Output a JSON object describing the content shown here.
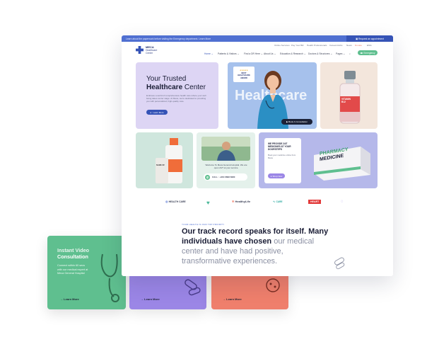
{
  "cards": {
    "green": {
      "title_line1": "Instant Video",
      "title_line2": "Consultation",
      "text_line1": "Connect within 60 secs",
      "text_line2": "with our medical expert at",
      "text_line3": "Meca General Hospital",
      "learn": "Learn More"
    },
    "purple": {
      "learn": "Learn More"
    },
    "orange": {
      "learn": "Learn More"
    }
  },
  "topbar": {
    "notice": "Learn about the paperwork before visiting the Emergency department. Learn More",
    "button": "Request an appointment"
  },
  "utility": [
    "Online Services",
    "Pay Your Bill",
    "Health Professionals",
    "Careers/Jobs",
    "News",
    "Donate",
    "ENG"
  ],
  "logo": {
    "line1": "MECA",
    "line2": "Healthcare",
    "line3": "Center"
  },
  "nav": [
    "Home",
    "Patients & Visitors",
    "Find a DR Here",
    "About Us",
    "Education & Research",
    "Doctors & Structures",
    "Pages"
  ],
  "appointment_button": "Emergency",
  "hero": {
    "title_line1": "Your Trusted",
    "title_bold": "Healthcare",
    "title_rest": " Center",
    "sub": "Embrace a world of comprehensive health care where your well being takes center stage. At Meca, we're dedicated to providing you with personalized, high-quality care.",
    "button": "Learn More"
  },
  "hero_image": {
    "badge_line1": "BEST",
    "badge_line2": "HEALTHCARE",
    "badge_line3": "AWARD",
    "overlay": "Healthcare",
    "consult": "Book A Consultation"
  },
  "vial": {
    "label_line1": "VITAMIN",
    "label_line2": "B12"
  },
  "welcome": {
    "text_line1": "Welcome To Meca General Hospital. We are",
    "text_line2": "open 24/7 at your service.",
    "call": "CALL : +964 6898 6980"
  },
  "pharmacy": {
    "heading_line1": "WE PROVIDE 24/7",
    "heading_line2": "MEDICINES AT YOUR",
    "heading_line3": "DOORSTEPS",
    "sub": "Book your medicine online from Meca",
    "button": "Shop Now",
    "box_line1": "PHARMACY",
    "box_line2": "MEDICINE"
  },
  "bottle": {
    "label": "NAME OF"
  },
  "brands": [
    "HEALTH CARE",
    "HealthyLife",
    "CARE",
    "HEART"
  ],
  "track": {
    "eyebrow": "YOUR HEALTH IS OUR TOP PRIORITY",
    "dark": "Our track record speaks for itself. Many individuals have chosen",
    "light": " our medical center and have had positive, transformative experiences."
  },
  "colors": {
    "green": "#5fbf8f",
    "purple": "#9b86e6",
    "orange": "#ef7f6c",
    "blue": "#4f6fd1",
    "lavender": "#ddd5f4"
  }
}
